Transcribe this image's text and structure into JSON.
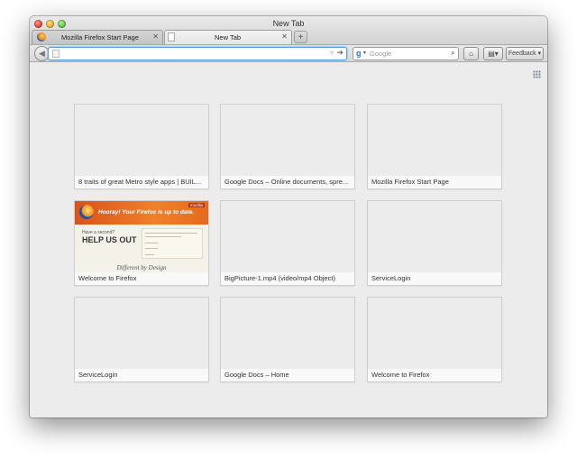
{
  "window": {
    "title": "New Tab"
  },
  "tabs": [
    {
      "label": "Mozilla Firefox Start Page",
      "active": false
    },
    {
      "label": "New Tab",
      "active": true
    }
  ],
  "navbar": {
    "url_value": "",
    "search": {
      "placeholder": "Google",
      "engine_icon": "google-g-icon"
    },
    "feedback_label": "Feedback"
  },
  "tiles": [
    {
      "label": "8 traits of great Metro style apps | BUIL..."
    },
    {
      "label": "Google Docs – Online documents, spre..."
    },
    {
      "label": "Mozilla Firefox Start Page"
    },
    {
      "label": "Welcome to Firefox",
      "thumbnail": {
        "headline": "Hooray! Your Firefox is up to date.",
        "badge": "mozilla",
        "have_a_second": "Have a second?",
        "help_us_out": "HELP US OUT",
        "different": "Different by Design"
      }
    },
    {
      "label": "BigPicture-1.mp4 (video/mp4 Object)"
    },
    {
      "label": "ServiceLogin"
    },
    {
      "label": "ServiceLogin"
    },
    {
      "label": "Google Docs – Home"
    },
    {
      "label": "Welcome to Firefox"
    }
  ]
}
